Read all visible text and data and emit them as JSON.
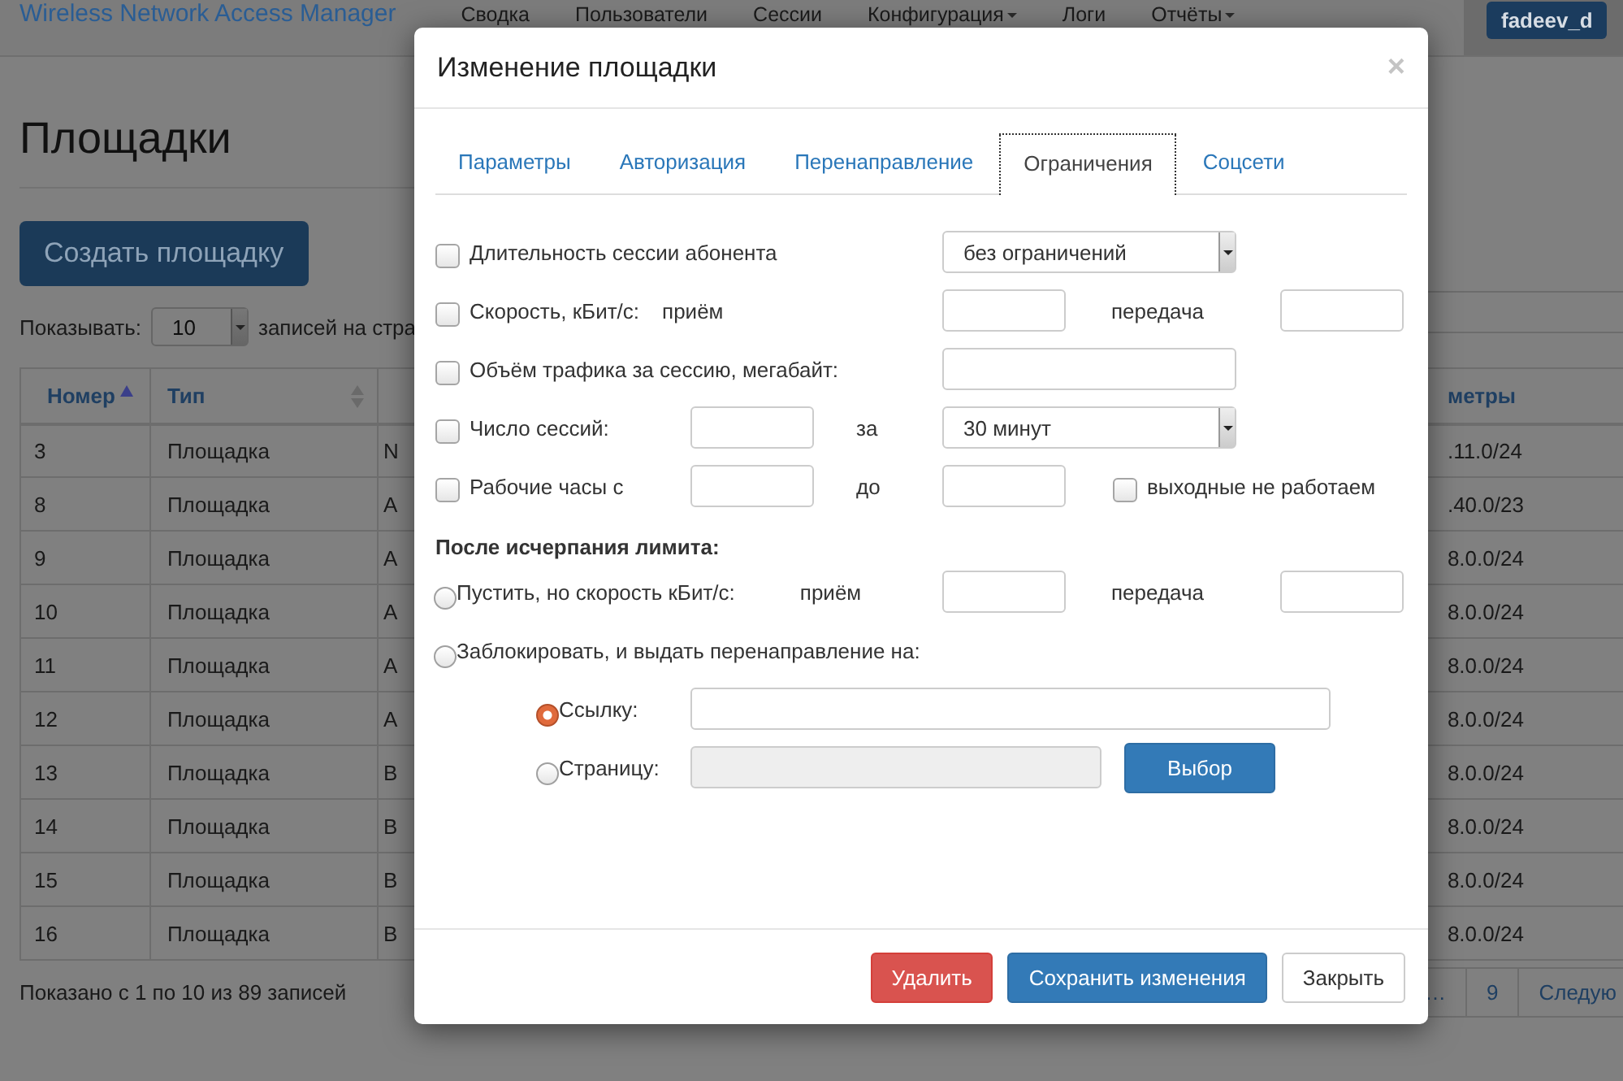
{
  "navbar": {
    "brand": "Wireless Network Access Manager",
    "menu": [
      {
        "label": "Сводка",
        "dropdown": false
      },
      {
        "label": "Пользователи",
        "dropdown": false
      },
      {
        "label": "Сессии",
        "dropdown": false
      },
      {
        "label": "Конфигурация",
        "dropdown": true
      },
      {
        "label": "Логи",
        "dropdown": false
      },
      {
        "label": "Отчёты",
        "dropdown": true
      }
    ],
    "user": "fadeev_d"
  },
  "page": {
    "title": "Площадки",
    "create_button": "Создать площадку",
    "length": {
      "label": "Показывать:",
      "value": "10",
      "suffix": "записей на стра"
    },
    "table": {
      "columns": [
        {
          "label": "Номер",
          "sorted": true
        },
        {
          "label": "Тип",
          "sorted": false
        },
        {},
        {
          "label": "метры"
        }
      ],
      "rows": [
        {
          "number": "3",
          "type": "Площадка",
          "column_3": "N",
          "column_4": ".11.0/24"
        },
        {
          "number": "8",
          "type": "Площадка",
          "column_3": "A",
          "column_4": ".40.0/23"
        },
        {
          "number": "9",
          "type": "Площадка",
          "column_3": "A",
          "column_4": "8.0.0/24"
        },
        {
          "number": "10",
          "type": "Площадка",
          "column_3": "A",
          "column_4": "8.0.0/24"
        },
        {
          "number": "11",
          "type": "Площадка",
          "column_3": "A",
          "column_4": "8.0.0/24"
        },
        {
          "number": "12",
          "type": "Площадка",
          "column_3": "A",
          "column_4": "8.0.0/24"
        },
        {
          "number": "13",
          "type": "Площадка",
          "column_3": "B",
          "column_4": "8.0.0/24"
        },
        {
          "number": "14",
          "type": "Площадка",
          "column_3": "B",
          "column_4": "8.0.0/24"
        },
        {
          "number": "15",
          "type": "Площадка",
          "column_3": "B",
          "column_4": "8.0.0/24"
        },
        {
          "number": "16",
          "type": "Площадка",
          "column_3": "B",
          "column_4": "8.0.0/24"
        }
      ]
    },
    "info": "Показано с 1 по 10 из 89 записей",
    "pagination": [
      "…",
      "9",
      "Следую"
    ]
  },
  "modal": {
    "title": "Изменение площадки",
    "close": "×",
    "tabs": [
      {
        "label": "Параметры",
        "selected": false
      },
      {
        "label": "Авторизация",
        "selected": false
      },
      {
        "label": "Перенаправление",
        "selected": false
      },
      {
        "label": "Ограничения",
        "selected": true
      },
      {
        "label": "Соцсети",
        "selected": false
      }
    ],
    "limits": [
      {
        "kind": "select",
        "label": "Длительность сессии абонента",
        "checked": false,
        "value": "без ограничений"
      },
      {
        "kind": "pair",
        "label": "Скорость, кБит/с:",
        "sublabel": "приём",
        "second_label": "передача",
        "checked": false
      },
      {
        "kind": "wide",
        "label": "Объём трафика за сессию, мегабайт:",
        "checked": false
      },
      {
        "kind": "count",
        "label": "Число сессий:",
        "joiner": "за",
        "value": "30 минут",
        "checked": false
      },
      {
        "kind": "hours",
        "label": "Рабочие часы с",
        "joiner": "до",
        "checked": false,
        "extra_label": "выходные не работаем",
        "extra_checked": false
      }
    ],
    "after_title": "После исчерпания лимита:",
    "after_options": [
      {
        "kind": "pair",
        "label": "Пустить, но скорость кБит/с:",
        "sublabel": "приём",
        "second_label": "передача",
        "selected": false
      },
      {
        "kind": "plain",
        "label": "Заблокировать, и выдать перенаправление на:",
        "selected": false
      }
    ],
    "redirect": [
      {
        "kind": "url",
        "label": "Ссылку:",
        "selected": true,
        "disabled": false
      },
      {
        "kind": "page",
        "label": "Страницу:",
        "selected": false,
        "disabled": true,
        "button": "Выбор"
      }
    ],
    "buttons": [
      {
        "label": "Удалить",
        "kind": "danger"
      },
      {
        "label": "Сохранить изменения",
        "kind": "primary"
      },
      {
        "label": "Закрыть",
        "kind": "default"
      }
    ]
  }
}
